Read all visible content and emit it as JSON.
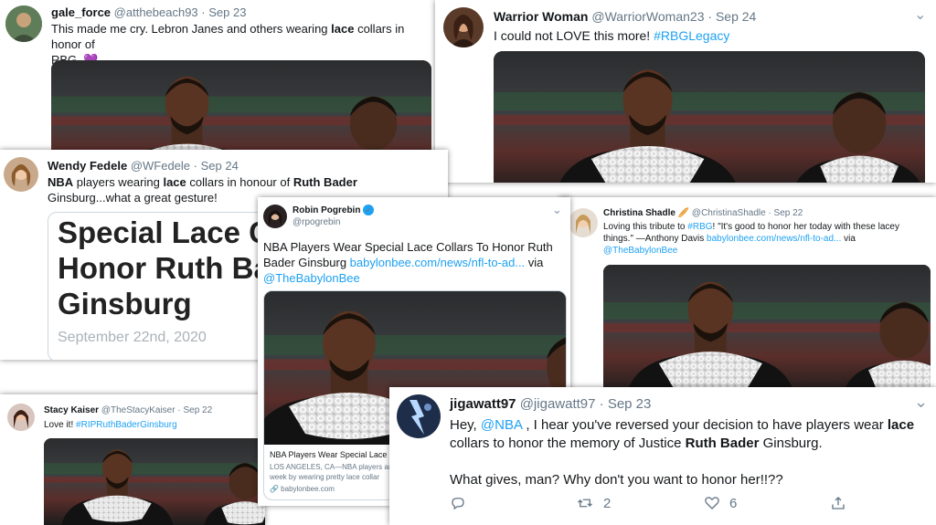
{
  "tweets": {
    "gale": {
      "name": "gale_force",
      "handle": "@atthebeach93",
      "date": "· Sep 23",
      "t1": "This made me cry. Lebron Janes and others wearing ",
      "b1": "lace",
      "t2": " collars in honor of",
      "t3": "RBG. ",
      "heart": "💜"
    },
    "warrior": {
      "name": "Warrior Woman",
      "handle": "@WarriorWoman23",
      "date": "· Sep 24",
      "t1": "I could not LOVE this more! ",
      "tag": "#RBGLegacy"
    },
    "wendy": {
      "name": "Wendy Fedele",
      "handle": "@WFedele",
      "date": "· Sep 24",
      "b1": "NBA",
      "t1": " players wearing ",
      "b2": "lace",
      "t2": " collars in honour of ",
      "b3": "Ruth Bader",
      "t3": " Ginsburg...what a great gesture!",
      "headline1": "Special Lace C",
      "headline2": "Honor Ruth Ba",
      "headline3": "Ginsburg",
      "article_date": "September 22nd, 2020"
    },
    "robin": {
      "name": "Robin Pogrebin",
      "handle": "@rpogrebin",
      "verified": "✓",
      "t1": "NBA Players Wear Special Lace Collars To Honor Ruth Bader Ginsburg ",
      "link": "babylonbee.com/news/nfl-to-ad...",
      "t2": " via",
      "mention": "@TheBabylonBee",
      "card_title": "NBA Players Wear Special Lace Col",
      "card_desc1": "LOS ANGELES, CA—NBA players ar",
      "card_desc2": "week by wearing pretty lace collar",
      "card_domain": "🔗 babylonbee.com"
    },
    "christina": {
      "name": "Christina Shadle",
      "emoji": "🥖",
      "handle": "@ChristinaShadle",
      "date": "· Sep 22",
      "t1": "Loving this tribute to ",
      "tag": "#RBG",
      "t2": "!  \"It's good to honor her today with these lacey",
      "t3": "things.\" —Anthony Davis ",
      "link": "babylonbee.com/news/nfl-to-ad...",
      "t4": " via",
      "mention": "@TheBabylonBee"
    },
    "stacy": {
      "name": "Stacy Kaiser",
      "handle": "@TheStacyKaiser",
      "date": "· Sep 22",
      "t1": "Love it! ",
      "tag": "#RIPRuthBaderGinsburg"
    },
    "jig": {
      "name": "jigawatt97",
      "handle": "@jigawatt97",
      "date": "· Sep 23",
      "t1": "Hey, ",
      "mention": "@NBA",
      "t2": " , I hear you've reversed your decision to have players wear ",
      "b1": "lace",
      "t3": "collars to honor the memory of Justice ",
      "b2": "Ruth Bader",
      "t4": " Ginsburg.",
      "t5": "What gives, man? Why don't you want to honor her!!??",
      "retweets": "2",
      "likes": "6"
    }
  },
  "icons": {
    "chevron": "chevron-down-icon",
    "reply": "reply-icon",
    "retweet": "retweet-icon",
    "like": "heart-icon",
    "share": "share-icon"
  },
  "colors": {
    "link": "#1da1f2",
    "muted": "#657786",
    "jersey": "#111111",
    "lace": "#e8e8e8"
  }
}
